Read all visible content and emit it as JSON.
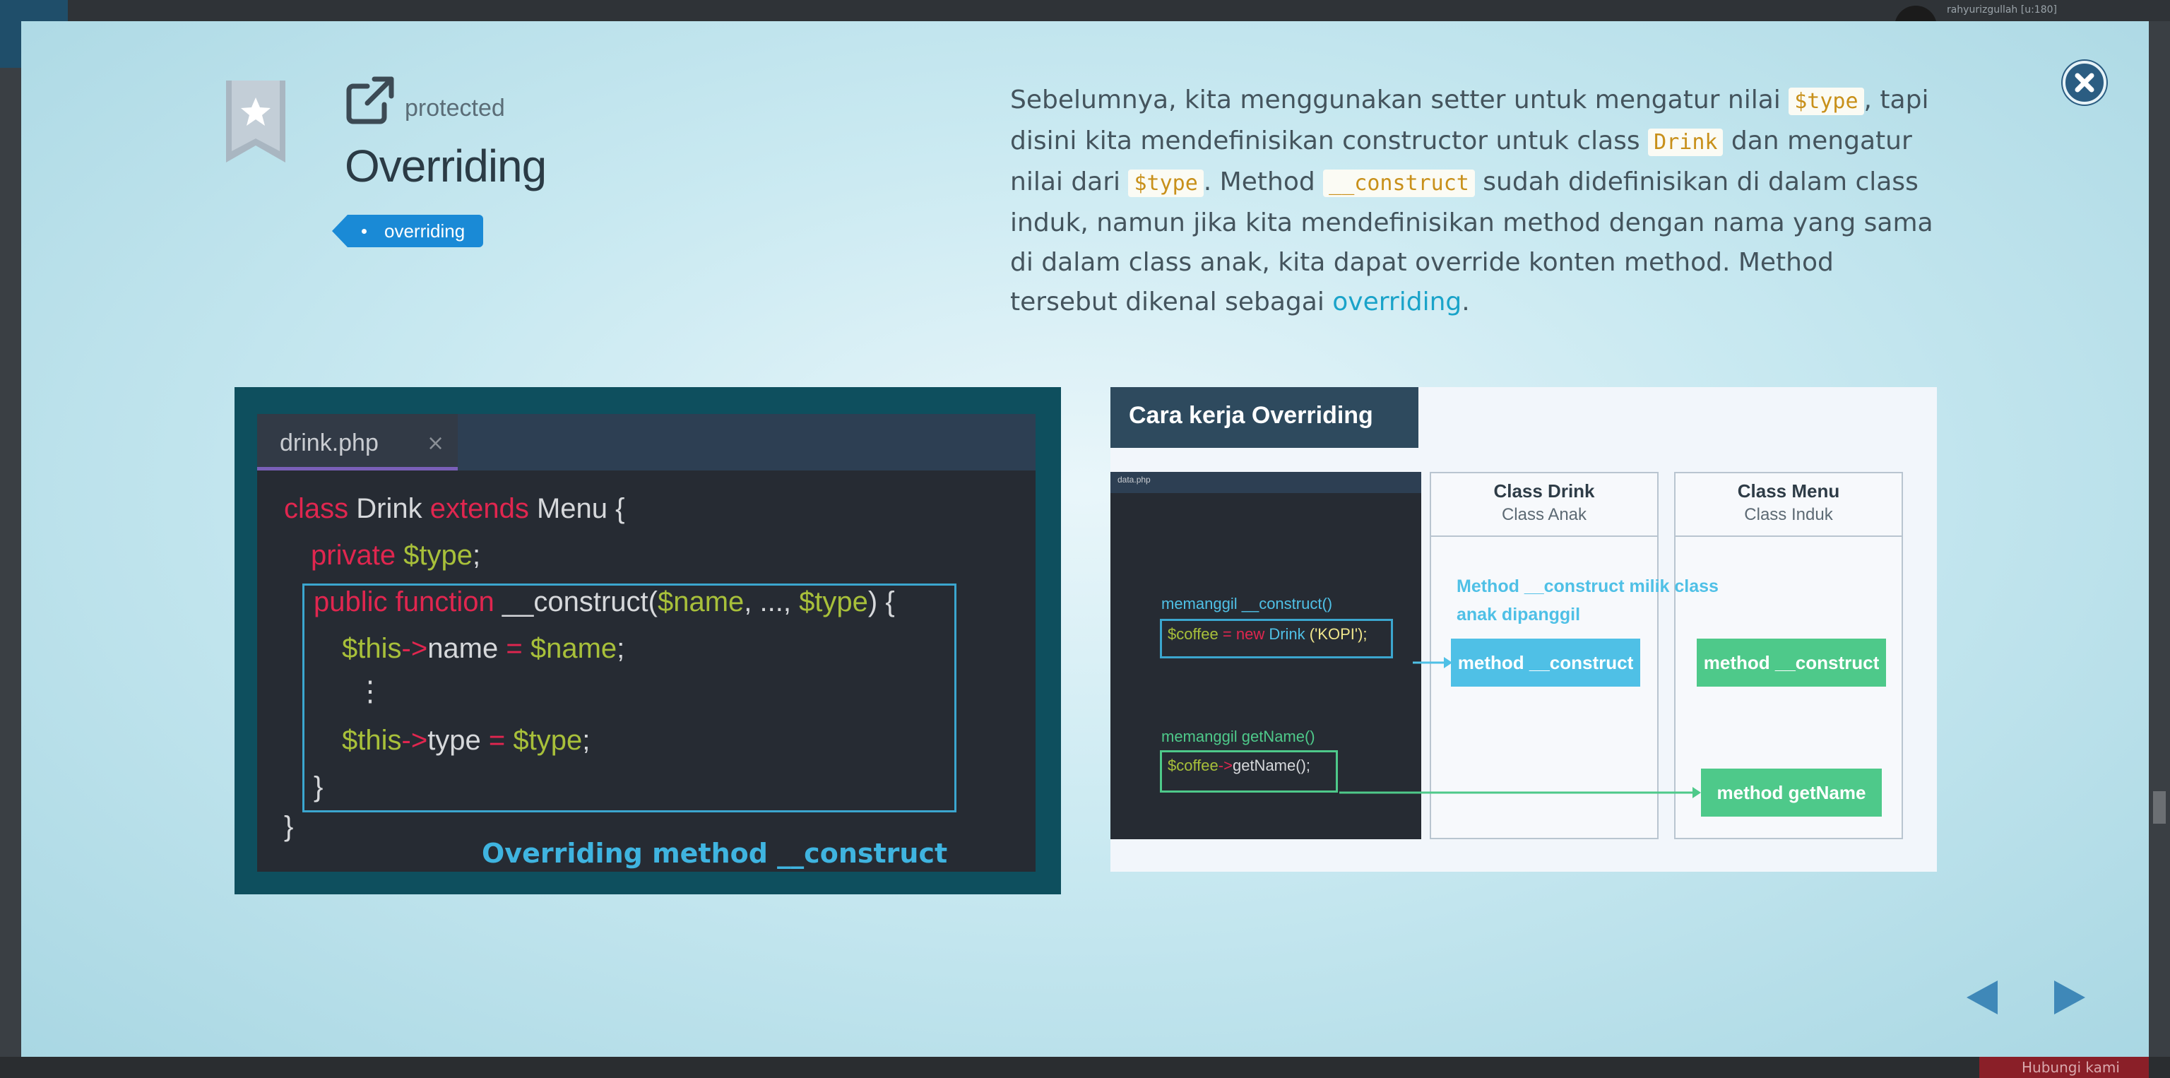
{
  "background": {
    "user_text": "rahyurizgullah [u:180]",
    "bottom_button": "Hubungi kami"
  },
  "modal": {
    "kind": "protected",
    "title": "Overriding",
    "tag": "overriding",
    "description": {
      "p1": "Sebelumnya, kita menggunakan setter untuk mengatur nilai ",
      "code1": "$type",
      "p2": ", tapi disini kita mendefinisikan constructor untuk class ",
      "code2": "Drink",
      "p3": " dan mengatur nilai dari ",
      "code3": "$type",
      "p4": ". Method ",
      "code4": "__construct",
      "p5": " sudah didefinisikan di dalam class induk, namun jika kita mendefinisikan method dengan nama yang sama di dalam class anak, kita dapat override konten method. Method tersebut dikenal sebagai ",
      "link": "overriding",
      "p6": "."
    }
  },
  "code_figure": {
    "tab_name": "drink.php",
    "tab_close": "×",
    "lines": {
      "l1_kw1": "class",
      "l1_name": " Drink ",
      "l1_kw2": "extends",
      "l1_rest": " Menu {",
      "l2_kw": "private",
      "l2_var": " $type",
      "l2_rest": ";",
      "l3_kw": "public function",
      "l3_fn": " __construct(",
      "l3_var1": "$name",
      "l3_mid": ", ..., ",
      "l3_var2": "$type",
      "l3_end": ") {",
      "l4_var": "$this",
      "l4_arrow": "->",
      "l4_prop": "name ",
      "l4_eq": "=",
      "l4_val": " $name",
      "l4_end": ";",
      "l5_dots": "⋮",
      "l6_var": "$this",
      "l6_arrow": "->",
      "l6_prop": "type ",
      "l6_eq": "=",
      "l6_val": " $type",
      "l6_end": ";",
      "l7": "}",
      "l8": "}"
    },
    "caption": "Overriding method __construct"
  },
  "diagram_figure": {
    "title": "Cara kerja Overriding",
    "editor_tab": "data.php",
    "label_construct": "memanggil __construct()",
    "code_construct": {
      "var": "$coffee",
      "eq": " = ",
      "kw": "new",
      "cls": " Drink ",
      "arg": "('KOPI');"
    },
    "label_getname": "memanggil  getName()",
    "code_getname": {
      "var": "$coffee",
      "arrow": "->",
      "rest": "getName();"
    },
    "col_drink": {
      "title": "Class Drink",
      "sub": "Class Anak"
    },
    "col_menu": {
      "title": "Class Menu",
      "sub": "Class Induk"
    },
    "note": "Method __construct milik class anak dipanggil",
    "method_drink_construct": "method __construct",
    "method_menu_construct": "method __construct",
    "method_menu_getname": "method getName"
  },
  "colors": {
    "accent_blue": "#1a8ad6",
    "diagram_blue": "#4fc0e6",
    "diagram_green": "#4ec98a",
    "code_keyword": "#e0264f",
    "code_variable": "#a8c03a"
  }
}
